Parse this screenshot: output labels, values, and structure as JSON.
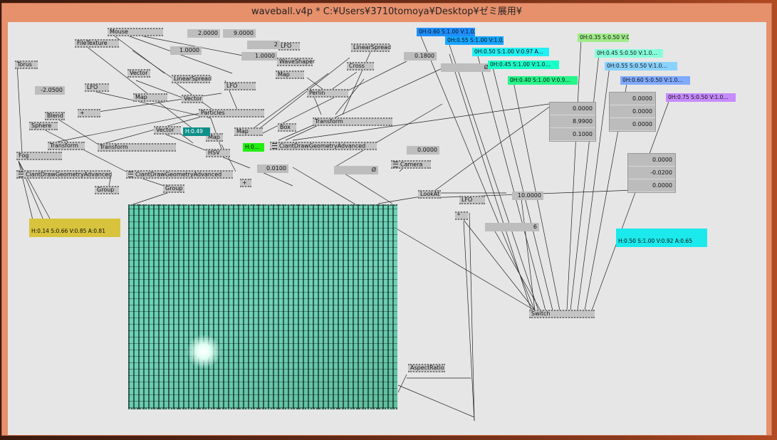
{
  "window": {
    "title": "waveball.v4p *  C:¥Users¥3710tomoya¥Desktop¥ゼミ展用¥"
  },
  "nodes": [
    {
      "label": "Mouse"
    },
    {
      "label": "FileTexture"
    },
    {
      "label": "Torus"
    },
    {
      "label": "Vector"
    },
    {
      "label": "LinearSpread"
    },
    {
      "label": "LFO"
    },
    {
      "label": "Map"
    },
    {
      "label": "Vector"
    },
    {
      "label": "LFO"
    },
    {
      "label": "+"
    },
    {
      "label": "Blend"
    },
    {
      "label": "Sphere"
    },
    {
      "label": "Particles"
    },
    {
      "label": "Vector"
    },
    {
      "label": "Map"
    },
    {
      "label": "Map"
    },
    {
      "label": "Box"
    },
    {
      "label": "Transform"
    },
    {
      "label": "Transform"
    },
    {
      "label": "HSV"
    },
    {
      "label": "Fog"
    },
    {
      "label": "CiantDrawGeometryAdvanced"
    },
    {
      "label": "CiantDrawGeometryAdvanced"
    },
    {
      "label": "CiantDrawGeometryAdvanced"
    },
    {
      "label": "Group"
    },
    {
      "label": "Group"
    },
    {
      "label": "+"
    },
    {
      "label": "LFO"
    },
    {
      "label": "WaveShaper"
    },
    {
      "label": "Map"
    },
    {
      "label": "LinearSpread"
    },
    {
      "label": "Cross"
    },
    {
      "label": "Perlin"
    },
    {
      "label": "Transform"
    },
    {
      "label": "Camera"
    },
    {
      "label": "LookAt"
    },
    {
      "label": "LFO"
    },
    {
      "label": "*"
    },
    {
      "label": "Switch"
    },
    {
      "label": "AspectRatio"
    }
  ],
  "values": {
    "v20000": "2.0000",
    "v90000": "9.0000",
    "v10000a": "1.0000",
    "v2": "2",
    "v10000b": "1.0000",
    "v01800": "0.1800",
    "vneg20500": "-2.0500",
    "vzero": "0.0000",
    "v00100": "0.0100",
    "vslash1": "Ø",
    "vslash2": "Ø",
    "v100000": "10.0000",
    "v6": "6"
  },
  "panel1": [
    "0.0000",
    "8.9900",
    "0.1000"
  ],
  "panel2": [
    "0.0000",
    "0.0000",
    "0.0000"
  ],
  "panel3": [
    "0.0000",
    "-0.0200",
    "0.0000"
  ],
  "colors": [
    {
      "text": "0H:0.60 S:1.00 V:1.0...",
      "hex": "#1f8fff"
    },
    {
      "text": "0H:0.55 S:1.00 V:1.0...",
      "hex": "#17a6ff"
    },
    {
      "text": "0H:0.50 S:1.00 V:0.97 A...",
      "hex": "#22f0f2"
    },
    {
      "text": "0H:0.45 S:1.00 V:1.0...",
      "hex": "#18ffc8"
    },
    {
      "text": "0H:0.40 S:1.00 V:0.9...",
      "hex": "#26f58a"
    },
    {
      "text": "0H:0.35 S:0.50 V:0.9...",
      "hex": "#a0ec8a"
    },
    {
      "text": "0H:0.45 S:0.50 V:1.0...",
      "hex": "#86ffd9"
    },
    {
      "text": "0H:0.55 S:0.50 V:1.0...",
      "hex": "#8ad2ff"
    },
    {
      "text": "0H:0.60 S:0.50 V:1.0...",
      "hex": "#80aaff"
    },
    {
      "text": "0H:0.75 S:0.50 V:1.0...",
      "hex": "#c68bff"
    },
    {
      "text": "H:0.49",
      "hex": "#0e8f8a"
    },
    {
      "text": "H:0...",
      "hex": "#22ee10"
    },
    {
      "text": "H:0.14  S:0.66  V:0.85  A:0.81",
      "hex": "#d8c43c"
    },
    {
      "text": "H:0.50  S:1.00  V:0.92  A:0.65",
      "hex": "#1ce9ec"
    }
  ]
}
